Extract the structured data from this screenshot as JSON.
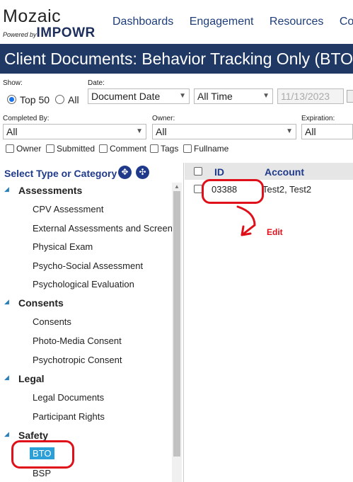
{
  "app": {
    "logo": "Mozaic",
    "powered_by": "Powered by",
    "brand": "IMPOWR"
  },
  "nav": {
    "items": [
      "Dashboards",
      "Engagement",
      "Resources",
      "Com"
    ]
  },
  "page_title": "Client Documents: Behavior Tracking Only (BTO",
  "filters": {
    "show_label": "Show:",
    "top50_label": "Top 50",
    "all_label": "All",
    "date_label": "Date:",
    "date_field": "Document Date",
    "date_range": "All Time",
    "date_value": "11/13/2023",
    "completed_by_label": "Completed By:",
    "completed_by_value": "All",
    "owner_label": "Owner:",
    "owner_value": "All",
    "expiration_label": "Expiration:",
    "expiration_value": "All",
    "checkboxes": [
      "Owner",
      "Submitted",
      "Comment",
      "Tags",
      "Fullname"
    ]
  },
  "left_panel": {
    "title": "Select Type or Category",
    "expand_icon": "expand-all-icon",
    "collapse_icon": "collapse-all-icon",
    "categories": [
      {
        "name": "Assessments",
        "items": [
          "CPV Assessment",
          "External Assessments and Screen",
          "Physical Exam",
          "Psycho-Social Assessment",
          "Psychological Evaluation"
        ]
      },
      {
        "name": "Consents",
        "items": [
          "Consents",
          "Photo-Media Consent",
          "Psychotropic Consent"
        ]
      },
      {
        "name": "Legal",
        "items": [
          "Legal Documents",
          "Participant Rights"
        ]
      },
      {
        "name": "Safety",
        "items": [
          "BTO",
          "BSP"
        ]
      }
    ]
  },
  "table": {
    "columns": [
      "ID",
      "Account"
    ],
    "rows": [
      {
        "id": "03388",
        "account": "Test2, Test2"
      }
    ]
  },
  "annotation": {
    "text": "Edit",
    "color": "#e0101a"
  },
  "colors": {
    "title_bar": "#1f3864",
    "nav_link": "#1d3d7a",
    "selected_item": "#2a9fd8",
    "header_blue": "#1f3a8a"
  }
}
